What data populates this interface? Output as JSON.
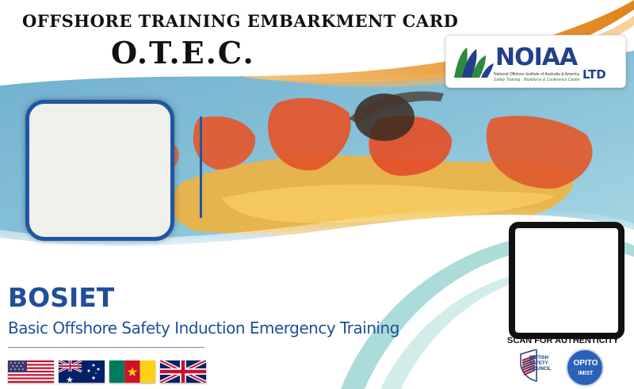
{
  "card": {
    "title": "OFFSHORE TRAINING EMBARKMENT CARD",
    "abbreviation": "O.T.E.C.",
    "background_icon": "liferaft-survivors-photo",
    "accent_colors": {
      "blue": "#1f57a3",
      "orange": "#e8902a",
      "teal": "#7bc8c4"
    }
  },
  "logo": {
    "name": "NOIAA",
    "suffix": "LTD",
    "subtitle": "National Offshore Institute of Australia & America",
    "tagline": "Safety Training · Workforce & Conference Centre"
  },
  "course": {
    "code": "BOSIET",
    "full_name": "Basic Offshore Safety Induction Emergency Training"
  },
  "verification": {
    "label": "SCAN FOR AUTHENTICITY"
  },
  "flags": [
    {
      "icon": "usa-flag-icon"
    },
    {
      "icon": "australia-flag-icon"
    },
    {
      "icon": "cameroon-flag-icon"
    },
    {
      "icon": "uk-flag-icon"
    }
  ],
  "accreditations": {
    "bsc_text": "BRITISH SAFETY COUNCIL",
    "opito_name": "OPITO",
    "opito_sub": "IMIST"
  }
}
